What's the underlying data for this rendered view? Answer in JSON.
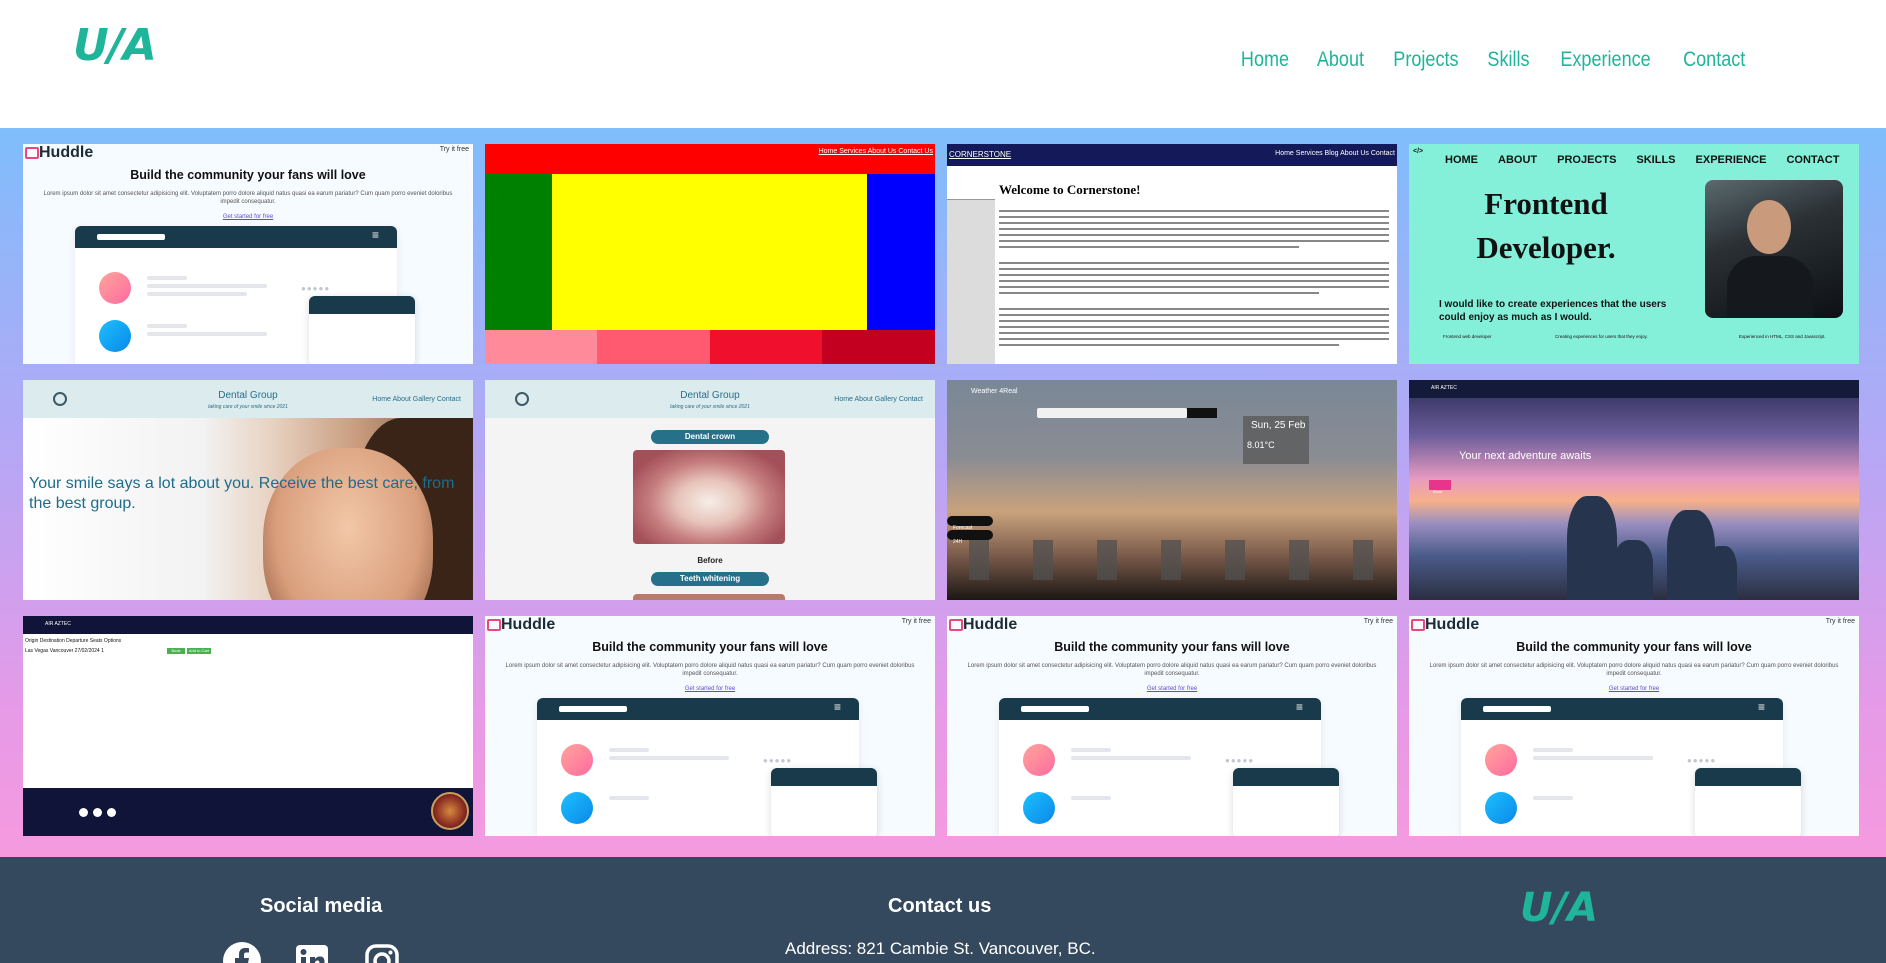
{
  "header": {
    "logo": "U/A",
    "nav": [
      "Home",
      "About",
      "Projects",
      "Skills",
      "Experience",
      "Contact"
    ]
  },
  "colors": {
    "accent": "#1fb59a",
    "footer_bg": "#34495e"
  },
  "projects": {
    "huddle": {
      "logo": "Huddle",
      "try": "Try it free",
      "title": "Build the community your fans will love",
      "subtitle": "Lorem ipsum dolor sit amet consectetur adipisicing elit. Voluptatem porro dolore aliquid natus quasi ea earum pariatur? Cum quam porro eveniet doloribus impedit consequatur.",
      "link": "Get started for free"
    },
    "colorblocks": {
      "nav": "Home  Services  About Us  Contact Us"
    },
    "cornerstone": {
      "brand": "CORNERSTONE",
      "nav": "Home   Services   Blog   About Us   Contact",
      "title": "Welcome to Cornerstone!"
    },
    "frontend": {
      "logo": "</>",
      "nav": [
        "HOME",
        "ABOUT",
        "PROJECTS",
        "SKILLS",
        "EXPERIENCE",
        "CONTACT"
      ],
      "title": "Frontend Developer.",
      "line": "I would like to create experiences that the users could enjoy as much as I would.",
      "col1": "Frontend web developer",
      "col2": "Creating experiences for users that they enjoy.",
      "col3": "Experienced in HTML, CSS and Javascript."
    },
    "dental": {
      "name": "Dental Group",
      "sub": "taking care of your smile since 2021",
      "nav": "Home   About   Gallery   Contact",
      "text": "Your smile says a lot about you. Receive the best care, from the best group.",
      "tag1": "Dental crown",
      "before": "Before",
      "tag2": "Teeth whitening"
    },
    "weather": {
      "brand": "Weather 4Real",
      "date": "Sun, 25 Feb",
      "temp": "8.01°C",
      "pill1": "Forecast",
      "pill2": "24H"
    },
    "adventure": {
      "brand": "AIR AZTEC",
      "title": "Your next adventure awaits",
      "cta": "Book"
    },
    "table": {
      "brand": "AIR AZTEC",
      "headers": "Origin     Destination     Departure     Seats     Options",
      "row": "Las Vegas   Vancouver   27/02/2024   1",
      "button1": "Book Now",
      "button2": "Add to Cart"
    }
  },
  "footer": {
    "social_title": "Social media",
    "social_icons": [
      "facebook-icon",
      "linkedin-icon",
      "instagram-icon"
    ],
    "contact_title": "Contact us",
    "address": "Address: 821 Cambie St. Vancouver, BC.",
    "logo": "U/A"
  }
}
